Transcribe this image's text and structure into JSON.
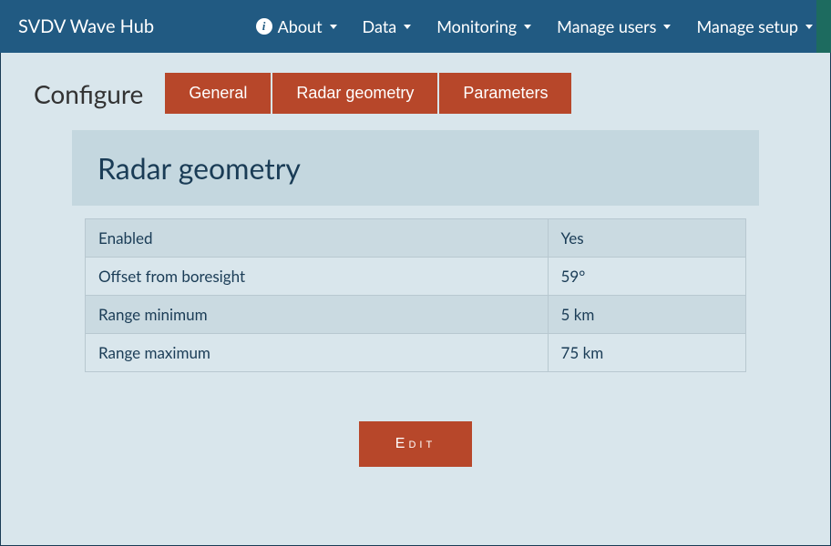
{
  "navbar": {
    "brand": "SVDV Wave Hub",
    "items": [
      {
        "label": "About",
        "hasIcon": true
      },
      {
        "label": "Data"
      },
      {
        "label": "Monitoring"
      },
      {
        "label": "Manage users"
      },
      {
        "label": "Manage setup"
      }
    ]
  },
  "page": {
    "title": "Configure",
    "tabs": [
      {
        "label": "General"
      },
      {
        "label": "Radar geometry"
      },
      {
        "label": "Parameters"
      }
    ]
  },
  "panel": {
    "title": "Radar geometry",
    "rows": [
      {
        "label": "Enabled",
        "value": "Yes"
      },
      {
        "label": "Offset from boresight",
        "value": "59°"
      },
      {
        "label": "Range minimum",
        "value": "5 km"
      },
      {
        "label": "Range maximum",
        "value": "75 km"
      }
    ],
    "editLabel": "Edit"
  }
}
